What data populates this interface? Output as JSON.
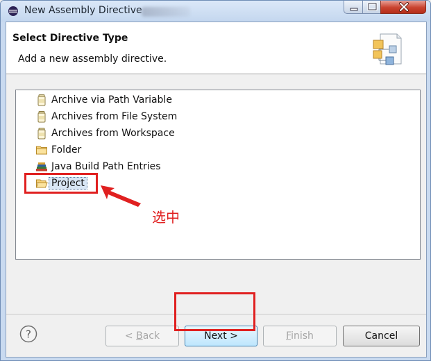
{
  "window": {
    "title": "New Assembly Directive"
  },
  "header": {
    "title": "Select Directive Type",
    "description": "Add a new assembly directive."
  },
  "tree": {
    "items": [
      {
        "label": "Archive via Path Variable",
        "icon": "jar-icon",
        "selected": false
      },
      {
        "label": "Archives from File System",
        "icon": "jar-icon",
        "selected": false
      },
      {
        "label": "Archives from Workspace",
        "icon": "jar-icon",
        "selected": false
      },
      {
        "label": "Folder",
        "icon": "folder-icon",
        "selected": false
      },
      {
        "label": "Java Build Path Entries",
        "icon": "library-icon",
        "selected": false
      },
      {
        "label": "Project",
        "icon": "open-folder-icon",
        "selected": true
      }
    ]
  },
  "annotation": {
    "text": "选中",
    "color": "#e02020"
  },
  "buttons": {
    "back": {
      "prefix": "< ",
      "mnemonic": "B",
      "rest": "ack",
      "enabled": false
    },
    "next": {
      "label": "Next >",
      "enabled": true
    },
    "finish": {
      "mnemonic": "F",
      "rest": "inish",
      "enabled": false
    },
    "cancel": {
      "label": "Cancel",
      "enabled": true
    }
  },
  "colors": {
    "accent": "#3c7fb1",
    "selection": "#d8e6f5",
    "annotation": "#e02020"
  }
}
